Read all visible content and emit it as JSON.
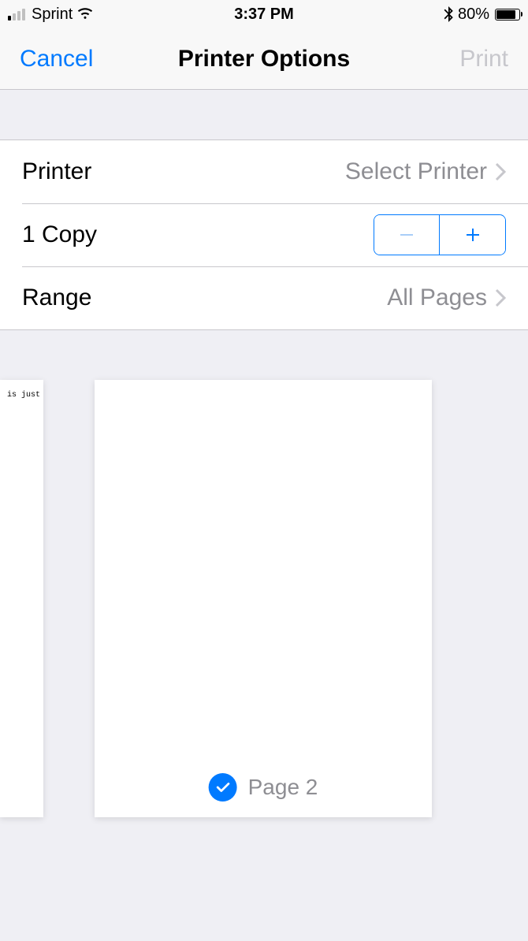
{
  "status_bar": {
    "carrier": "Sprint",
    "time": "3:37 PM",
    "battery_pct": "80%"
  },
  "nav": {
    "cancel": "Cancel",
    "title": "Printer Options",
    "print": "Print"
  },
  "rows": {
    "printer": {
      "label": "Printer",
      "value": "Select Printer"
    },
    "copies": {
      "label": "1 Copy"
    },
    "range": {
      "label": "Range",
      "value": "All Pages"
    }
  },
  "preview": {
    "sliver_text": "is just",
    "page_label": "Page 2"
  }
}
